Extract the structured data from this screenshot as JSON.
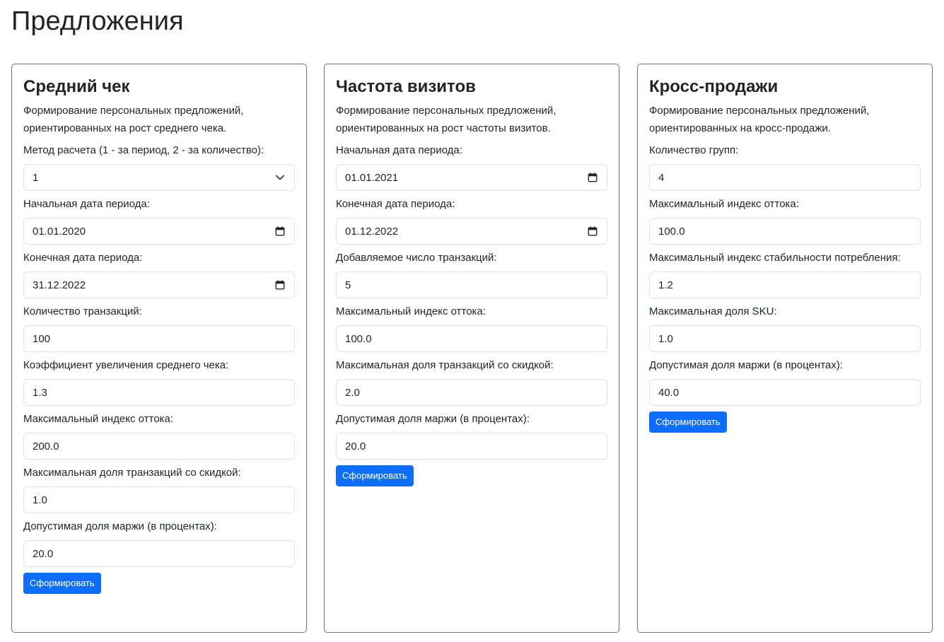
{
  "page": {
    "title": "Предложения"
  },
  "cards": {
    "avg_check": {
      "title": "Средний чек",
      "description": "Формирование персональных предложений, ориентированных на рост среднего чека.",
      "fields": [
        {
          "label": "Метод расчета (1 - за период, 2 - за количество):",
          "value": "1",
          "kind": "select"
        },
        {
          "label": "Начальная дата периода:",
          "value": "01.01.2020",
          "kind": "date"
        },
        {
          "label": "Конечная дата периода:",
          "value": "31.12.2022",
          "kind": "date"
        },
        {
          "label": "Количество транзакций:",
          "value": "100",
          "kind": "text"
        },
        {
          "label": "Коэффициент увеличения среднего чека:",
          "value": "1.3",
          "kind": "text"
        },
        {
          "label": "Максимальный индекс оттока:",
          "value": "200.0",
          "kind": "text"
        },
        {
          "label": "Максимальная доля транзакций со скидкой:",
          "value": "1.0",
          "kind": "text"
        },
        {
          "label": "Допустимая доля маржи (в процентах):",
          "value": "20.0",
          "kind": "text"
        }
      ],
      "button": "Сформировать"
    },
    "visit_freq": {
      "title": "Частота визитов",
      "description": "Формирование персональных предложений, ориентированных на рост частоты визитов.",
      "fields": [
        {
          "label": "Начальная дата периода:",
          "value": "01.01.2021",
          "kind": "date"
        },
        {
          "label": "Конечная дата периода:",
          "value": "01.12.2022",
          "kind": "date"
        },
        {
          "label": "Добавляемое число транзакций:",
          "value": "5",
          "kind": "text"
        },
        {
          "label": "Максимальный индекс оттока:",
          "value": "100.0",
          "kind": "text"
        },
        {
          "label": "Максимальная доля транзакций со скидкой:",
          "value": "2.0",
          "kind": "text"
        },
        {
          "label": "Допустимая доля маржи (в процентах):",
          "value": "20.0",
          "kind": "text"
        }
      ],
      "button": "Сформировать"
    },
    "cross_sell": {
      "title": "Кросс-продажи",
      "description": "Формирование персональных предложений, ориентированных на кросс-продажи.",
      "fields": [
        {
          "label": "Количество групп:",
          "value": "4",
          "kind": "text"
        },
        {
          "label": "Максимальный индекс оттока:",
          "value": "100.0",
          "kind": "text"
        },
        {
          "label": "Максимальный индекс стабильности потребления:",
          "value": "1.2",
          "kind": "text"
        },
        {
          "label": "Максимальная доля SKU:",
          "value": "1.0",
          "kind": "text"
        },
        {
          "label": "Допустимая доля маржи (в процентах):",
          "value": "40.0",
          "kind": "text"
        }
      ],
      "button": "Сформировать"
    }
  },
  "icons": {
    "select": "chevron-down-icon",
    "date": "calendar-icon"
  },
  "colors": {
    "primary": "#0d6efd",
    "border": "#dee2e6",
    "card_border": "#6c757d",
    "text": "#212529"
  }
}
